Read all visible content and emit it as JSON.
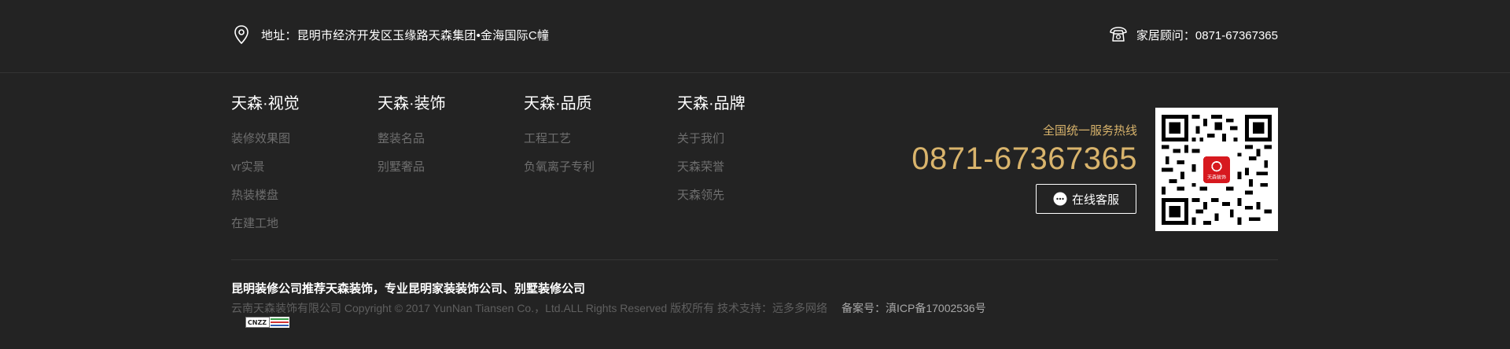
{
  "top_bar": {
    "address": "地址：昆明市经济开发区玉缘路天森集团•金海国际C幢",
    "phone": "家居顾问：0871-67367365"
  },
  "columns": [
    {
      "title": "天森·视觉",
      "links": [
        "装修效果图",
        "vr实景",
        "热装楼盘",
        "在建工地"
      ]
    },
    {
      "title": "天森·装饰",
      "links": [
        "整装名品",
        "别墅奢品"
      ]
    },
    {
      "title": "天森·品质",
      "links": [
        "工程工艺",
        "负氧离子专利"
      ]
    },
    {
      "title": "天森·品牌",
      "links": [
        "关于我们",
        "天森荣誉",
        "天森领先"
      ]
    }
  ],
  "hotline": {
    "label": "全国统一服务热线",
    "number": "0871-67367365",
    "service_button": "在线客服"
  },
  "qr": {
    "logo_text": "天森装饰"
  },
  "bottom": {
    "slogan": "昆明装修公司推荐天森装饰，专业昆明家装装饰公司、别墅装修公司",
    "copyright": "云南天森装饰有限公司 Copyright © 2017 YunNan Tiansen Co.，Ltd.ALL Rights Reserved 版权所有 技术支持：远多多网络",
    "icp": "备案号：滇ICP备17002536号",
    "cnzz": "CNZZ"
  },
  "colors": {
    "background": "#232323",
    "accent_gold": "#d9b46c",
    "link_gray": "#6e6e6e",
    "brand_red": "#d7191f"
  },
  "icons": [
    "location-pin-icon",
    "telephone-icon",
    "chat-bubble-icon",
    "qr-code"
  ]
}
